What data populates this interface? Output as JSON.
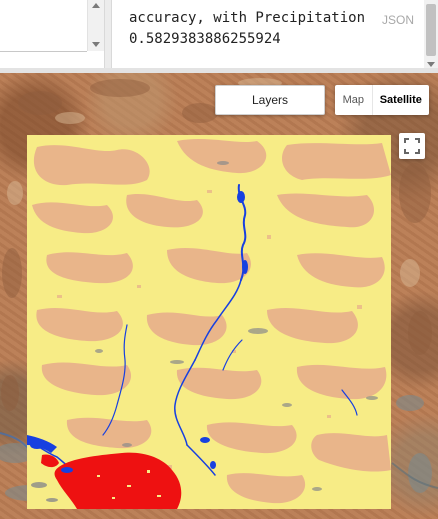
{
  "console": {
    "output_label": "accuracy, with Precipitation",
    "output_value": "0.5829383886255924",
    "json_tag": "JSON"
  },
  "map": {
    "layers_button": "Layers",
    "map_type": {
      "map_label": "Map",
      "satellite_label": "Satellite",
      "selected": "Satellite"
    },
    "fullscreen_icon": "fullscreen-icon",
    "overlay_colors": {
      "desert_yellow": "#f7ec86",
      "sand_tan": "#e9b58a",
      "water_blue": "#1740e0",
      "urban_red": "#ee1111",
      "rock_gray": "#8a8a8a"
    }
  }
}
